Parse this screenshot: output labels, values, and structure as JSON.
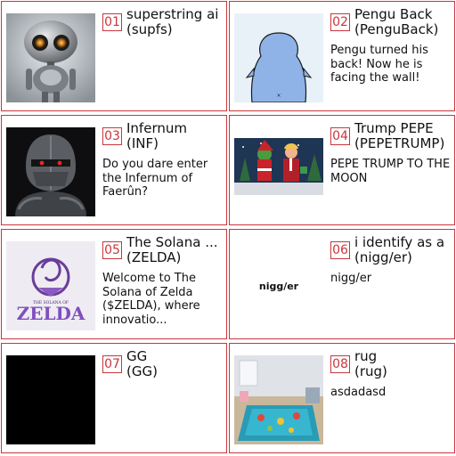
{
  "tokens": [
    {
      "num": "01",
      "name": "superstring ai",
      "ticker": "(supfs)",
      "desc": "",
      "image": "robot-image"
    },
    {
      "num": "02",
      "name": "Pengu Back",
      "ticker": "(PenguBack)",
      "desc": "Pengu turned his back! Now he is facing the wall!",
      "image": "pengu-image"
    },
    {
      "num": "03",
      "name": "Infernum",
      "ticker": "(INF)",
      "desc": "Do you dare enter the Infernum of Faerûn?",
      "image": "knight-image"
    },
    {
      "num": "04",
      "name": "Trump PEPE",
      "ticker": "(PEPETRUMP)",
      "desc": "PEPE TRUMP TO THE MOON",
      "image": "pepe-trump-image"
    },
    {
      "num": "05",
      "name": "The Solana ...",
      "ticker": "(ZELDA)",
      "desc": "Welcome to The Solana of Zelda 󠁿󠁿 ($ZELDA), where innovatio...",
      "image": "zelda-logo-image",
      "logo_small": "THE SOLANA OF",
      "logo_big": "ZELDA"
    },
    {
      "num": "06",
      "name": "i identify as a",
      "ticker": "(nigg/er)",
      "desc": "nigg/er",
      "image": "text-image",
      "image_text": "nigg/er"
    },
    {
      "num": "07",
      "name": "GG",
      "ticker": "(GG)",
      "desc": "",
      "image": "black-image"
    },
    {
      "num": "08",
      "name": "rug",
      "ticker": "(rug)",
      "desc": "asdadasd",
      "image": "rug-room-image"
    }
  ],
  "colors": {
    "accent": "#c8373c"
  }
}
